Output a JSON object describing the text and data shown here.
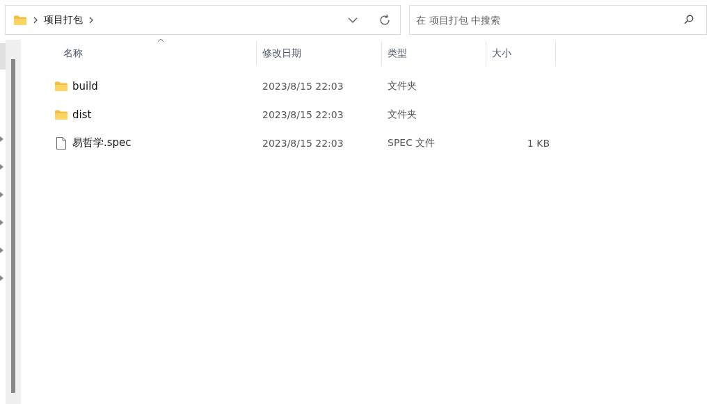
{
  "address_bar": {
    "path": [
      "项目打包"
    ]
  },
  "search": {
    "placeholder": "在 项目打包 中搜索"
  },
  "columns": [
    {
      "label": "名称",
      "sorted": true
    },
    {
      "label": "修改日期",
      "sorted": false
    },
    {
      "label": "类型",
      "sorted": false
    },
    {
      "label": "大小",
      "sorted": false
    }
  ],
  "files": [
    {
      "kind": "folder",
      "name": "build",
      "modified": "2023/8/15 22:03",
      "type": "文件夹"
    },
    {
      "kind": "folder",
      "name": "dist",
      "modified": "2023/8/15 22:03",
      "type": "文件夹"
    },
    {
      "kind": "file",
      "name": "易哲学.spec",
      "modified": "2023/8/15 22:03",
      "type": "SPEC 文件",
      "size": "1 KB"
    }
  ]
}
